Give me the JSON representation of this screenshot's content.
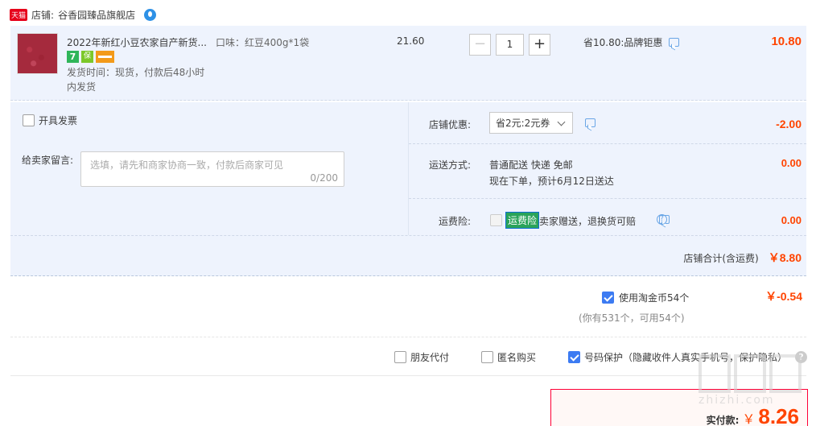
{
  "shop": {
    "badge": "天猫",
    "label": "店铺:",
    "name": "谷香园臻品旗舰店"
  },
  "item": {
    "title": "2022年新红小豆农家自产新货...",
    "variant": "口味：红豆400g*1袋",
    "unit_price": "21.60",
    "quantity": "1",
    "promo": "省10.80:品牌钜惠",
    "subtotal": "10.80",
    "ship_time_line1": "发货时间：现货，付款后48小时",
    "ship_time_line2": "内发货",
    "badges": [
      "7",
      "保"
    ],
    "icons": [
      "seven-day-return-icon",
      "guarantee-icon",
      "card-payment-icon"
    ]
  },
  "options": {
    "invoice_label": "开具发票",
    "message_label": "给卖家留言:",
    "message_placeholder": "选填，请先和商家协商一致，付款后商家可见",
    "message_count": "0/200"
  },
  "shop_discount": {
    "label": "店铺优惠:",
    "selected": "省2元:2元券",
    "amount": "-2.00"
  },
  "shipping": {
    "label": "运送方式:",
    "method": "普通配送 快递 免邮",
    "eta": "现在下单，预计6月12日送达",
    "amount": "0.00"
  },
  "insurance": {
    "label": "运费险:",
    "tag": "运费险",
    "desc": "卖家赠送，退换货可赔",
    "amount": "0.00"
  },
  "shop_total": {
    "label": "店铺合计(含运费)",
    "amount": "￥8.80"
  },
  "coins": {
    "label": "使用淘金币54个",
    "amount": "￥-0.54",
    "note": "(你有531个，可用54个)"
  },
  "bottom_options": {
    "friend_pay": "朋友代付",
    "anonymous": "匿名购买",
    "number_protect": "号码保护（隐藏收件人真实手机号，保护隐私）"
  },
  "pay": {
    "label": "实付款:",
    "symbol": "￥",
    "amount": "8.26"
  },
  "watermark": "zhizhi.com",
  "colors": {
    "accent_red": "#ff4400",
    "brand_blue": "#3c7bf2",
    "panel_bg": "#eef3fd",
    "tmall_red": "#e6001a"
  }
}
